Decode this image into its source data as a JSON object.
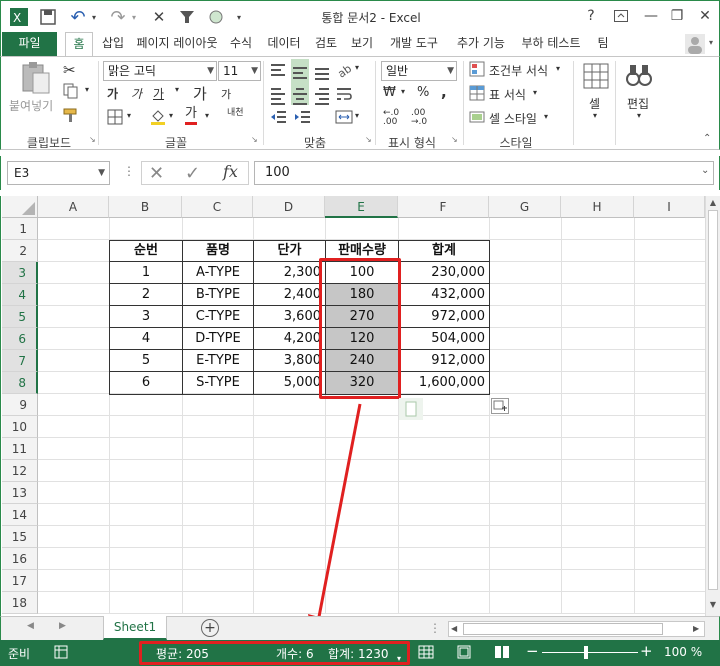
{
  "window": {
    "title": "통합 문서2 - Excel",
    "help": "?",
    "minimize": "—",
    "restore": "❐",
    "close": "✕"
  },
  "qat": {
    "undo": "↶",
    "redo": "↷"
  },
  "tabs": [
    {
      "label": "파일"
    },
    {
      "label": "홈"
    },
    {
      "label": "삽입"
    },
    {
      "label": "페이지 레이아웃"
    },
    {
      "label": "수식"
    },
    {
      "label": "데이터"
    },
    {
      "label": "검토"
    },
    {
      "label": "보기"
    },
    {
      "label": "개발 도구"
    },
    {
      "label": "추가 기능"
    },
    {
      "label": "부하 테스트"
    },
    {
      "label": "팀"
    }
  ],
  "ribbon": {
    "paste_label": "붙여넣기",
    "groups": {
      "clipboard": "클립보드",
      "font": "글꼴",
      "alignment": "맞춤",
      "number": "표시 형식",
      "styles": "스타일",
      "cells": "셀",
      "editing": "편집"
    },
    "font_name": "맑은 고딕",
    "font_size": "11",
    "bold": "가",
    "italic": "가",
    "underline": "가",
    "grow": "가",
    "shrink": "가",
    "fontcolor": "가",
    "phonetic": "내천",
    "number_format": "일반",
    "currency": "₩",
    "percent": "%",
    "comma": ",",
    "cond_format": "조건부 서식",
    "table_format": "표 서식",
    "cell_style": "셀 스타일",
    "cells_label": "셀",
    "editing_label": "편집"
  },
  "formula_bar": {
    "name_box": "E3",
    "fx": "fx",
    "value": "100"
  },
  "columns": [
    "A",
    "B",
    "C",
    "D",
    "E",
    "F",
    "G",
    "H",
    "I"
  ],
  "rows": [
    "1",
    "2",
    "3",
    "4",
    "5",
    "6",
    "7",
    "8",
    "9",
    "10",
    "11",
    "12",
    "13",
    "14",
    "15",
    "16",
    "17",
    "18"
  ],
  "table": {
    "headers": [
      "순번",
      "품명",
      "단가",
      "판매수량",
      "합계"
    ],
    "rows": [
      [
        "1",
        "A-TYPE",
        "2,300",
        "100",
        "230,000"
      ],
      [
        "2",
        "B-TYPE",
        "2,400",
        "180",
        "432,000"
      ],
      [
        "3",
        "C-TYPE",
        "3,600",
        "270",
        "972,000"
      ],
      [
        "4",
        "D-TYPE",
        "4,200",
        "120",
        "504,000"
      ],
      [
        "5",
        "E-TYPE",
        "3,800",
        "240",
        "912,000"
      ],
      [
        "6",
        "S-TYPE",
        "5,000",
        "320",
        "1,600,000"
      ]
    ]
  },
  "sheet_tab": "Sheet1",
  "status": {
    "ready": "준비",
    "average": "평균: 205",
    "count": "개수: 6",
    "sum": "합계: 1230",
    "zoom": "100 %"
  },
  "colors": {
    "accent": "#217346",
    "highlight": "#e02020",
    "selection": "#c6c6c6"
  }
}
